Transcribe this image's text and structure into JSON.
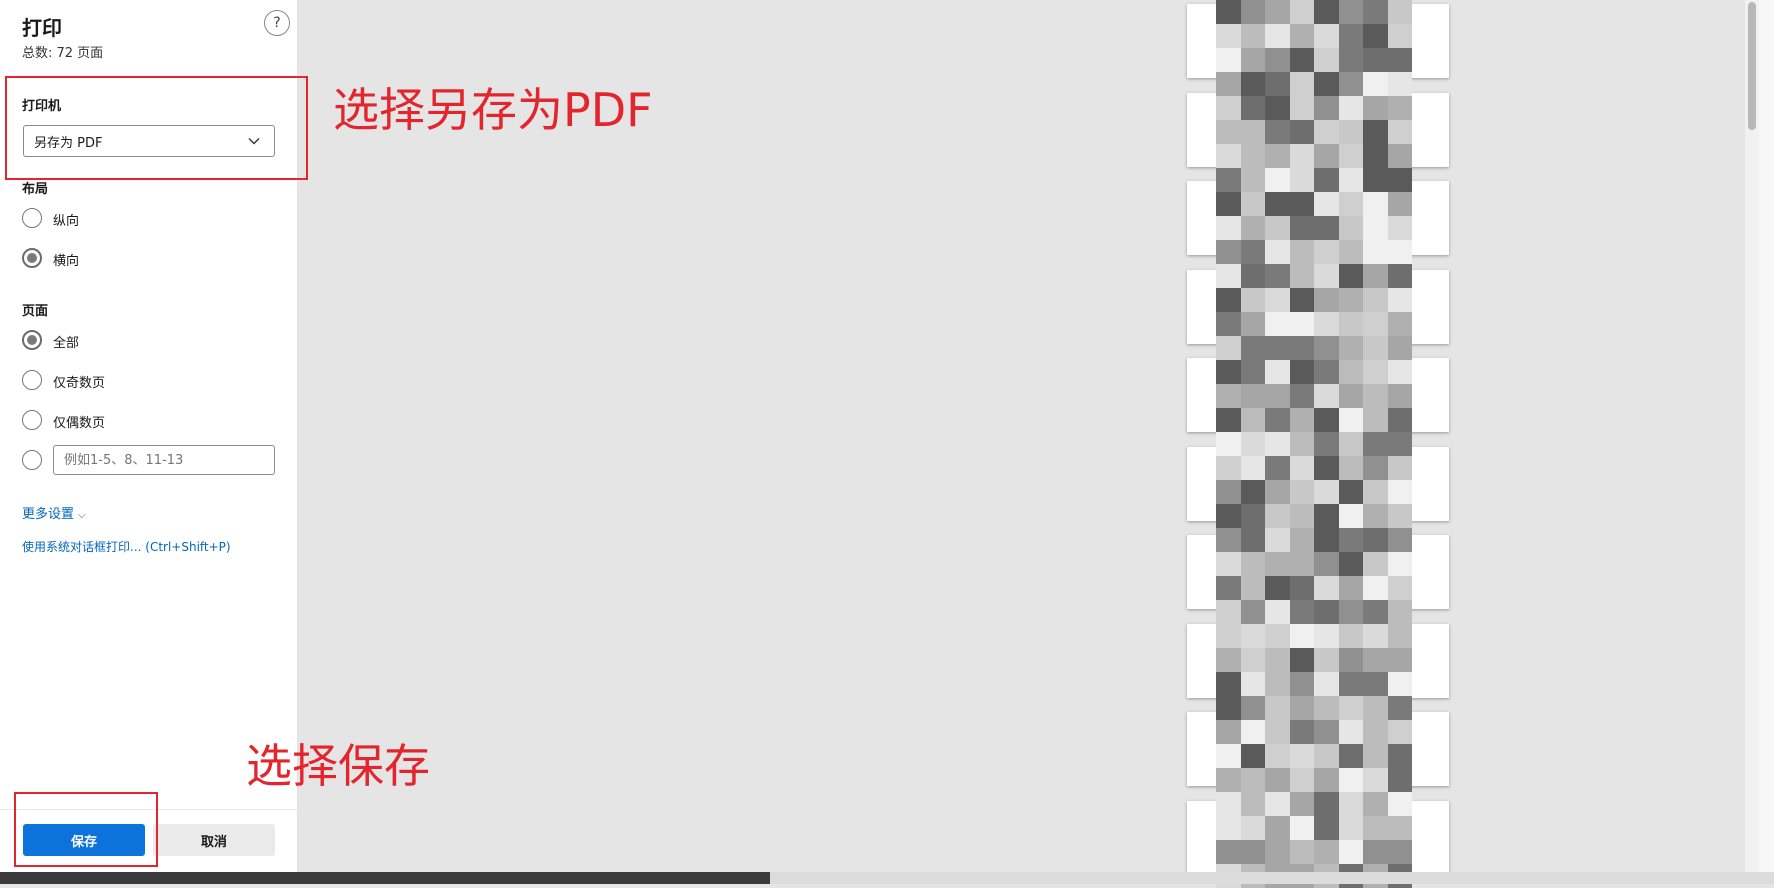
{
  "dialog": {
    "title": "打印",
    "total_pages": "总数: 72 页面",
    "help_label": "?"
  },
  "printer": {
    "label": "打印机",
    "selected": "另存为 PDF"
  },
  "layout": {
    "label": "布局",
    "options": [
      "纵向",
      "横向"
    ],
    "selected": "横向"
  },
  "pages": {
    "label": "页面",
    "options": [
      "全部",
      "仅奇数页",
      "仅偶数页"
    ],
    "selected": "全部",
    "custom_placeholder": "例如1-5、8、11-13"
  },
  "more_settings": "更多设置",
  "system_dialog_link": "使用系统对话框打印... (Ctrl+Shift+P)",
  "buttons": {
    "save": "保存",
    "cancel": "取消"
  },
  "annotations": {
    "select_pdf": "选择另存为PDF",
    "select_save": "选择保存"
  },
  "colors": {
    "accent": "#0b73d9",
    "annotation": "#e3262d"
  }
}
